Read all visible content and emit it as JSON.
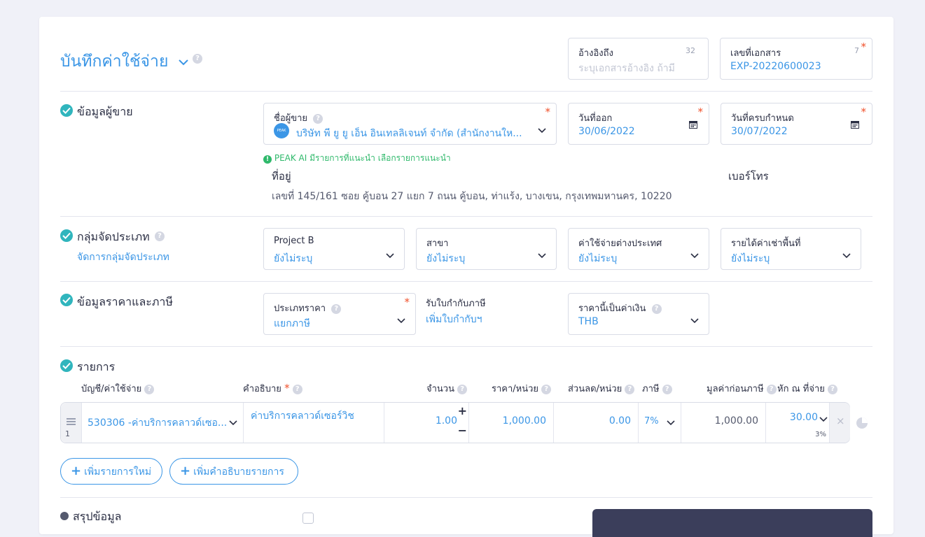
{
  "header": {
    "title": "บันทึกค่าใช้จ่าย",
    "reference": {
      "label": "อ้างอิงถึง",
      "counter": "32",
      "placeholder": "ระบุเอกสารอ้างอิง ถ้ามี"
    },
    "doc_number": {
      "label": "เลขที่เอกสาร",
      "counter": "7",
      "value": "EXP-20220600023"
    }
  },
  "vendor": {
    "section_title": "ข้อมูลผู้ขาย",
    "vendor_name": {
      "label": "ชื่อผู้ขาย",
      "value": "บริษัท พี ยู ยู เอ็น อินเทลลิเจนท์ จำกัด (สำนักงานให...",
      "logo_text": "PEAK"
    },
    "issue_date": {
      "label": "วันที่ออก",
      "value": "30/06/2022"
    },
    "due_date": {
      "label": "วันที่ครบกำหนด",
      "value": "30/07/2022"
    },
    "ai_hint": "PEAK AI มีรายการที่แนะนำ เลือกรายการแนะนำ",
    "address_label": "ที่อยู่",
    "address_value": "เลขที่ 145/161 ซอย คู้บอน 27 แยก 7 ถนน คู้บอน, ท่าแร้ง, บางเขน, กรุงเทพมหานคร, 10220",
    "phone_label": "เบอร์โทร"
  },
  "classification": {
    "section_title": "กลุ่มจัดประเภท",
    "manage_link": "จัดการกลุ่มจัดประเภท",
    "fields": [
      {
        "label": "Project B",
        "value": "ยังไม่ระบุ"
      },
      {
        "label": "สาขา",
        "value": "ยังไม่ระบุ"
      },
      {
        "label": "ค่าใช้จ่ายต่างประเทศ",
        "value": "ยังไม่ระบุ"
      },
      {
        "label": "รายได้ค่าเช่าพื้นที่",
        "value": "ยังไม่ระบุ"
      }
    ]
  },
  "pricing": {
    "section_title": "ข้อมูลราคาและภาษี",
    "price_type": {
      "label": "ประเภทราคา",
      "value": "แยกภาษี"
    },
    "tax_invoice": {
      "label": "รับใบกำกับภาษี",
      "link": "เพิ่มใบกำกับฯ"
    },
    "currency": {
      "label": "ราคานี้เป็นค่าเงิน",
      "value": "THB"
    }
  },
  "items": {
    "section_title": "รายการ",
    "columns": [
      "บัญชี/ค่าใช้จ่าย",
      "คำอธิบาย",
      "จำนวน",
      "ราคา/หน่วย",
      "ส่วนลด/หน่วย",
      "ภาษี",
      "มูลค่าก่อนภาษี",
      "หัก ณ ที่จ่าย"
    ],
    "rows": [
      {
        "index": "1",
        "account": "530306 -ค่าบริการคลาวด์เซอ...",
        "description": "ค่าบริการคลาวด์เซอร์วิช",
        "quantity": "1.00",
        "unit_price": "1,000.00",
        "discount": "0.00",
        "vat": "7%",
        "amount_before_tax": "1,000.00",
        "withholding": "30.00",
        "withholding_rate": "3%"
      }
    ],
    "add_item_button": "เพิ่มรายการใหม่",
    "add_description_button": "เพิ่มคำอธิบายรายการ"
  },
  "summary": {
    "section_title": "สรุปข้อมูล"
  },
  "colors": {
    "accent": "#3b96e6",
    "check": "#30b5bd",
    "required": "#f0502a",
    "ai_hint": "#2fb96b"
  }
}
